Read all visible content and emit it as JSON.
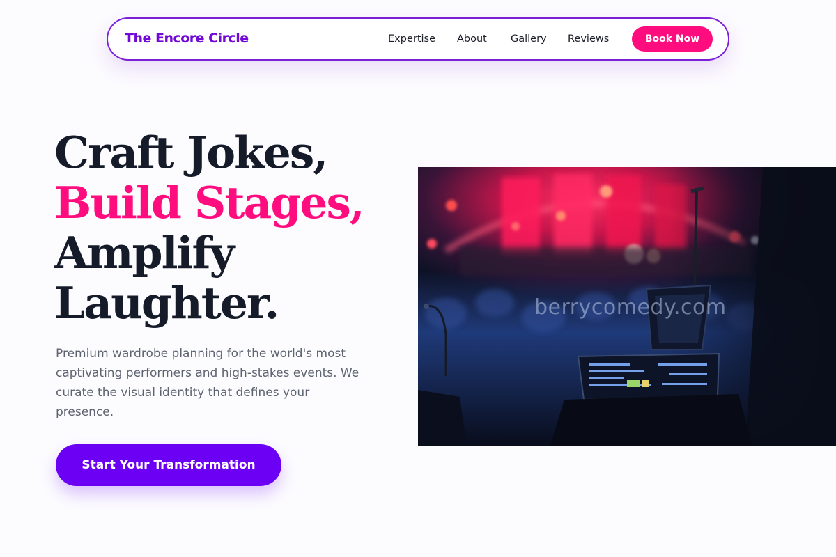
{
  "nav": {
    "brand": "The Encore Circle",
    "links": [
      "Expertise",
      "About",
      "Gallery",
      "Reviews"
    ],
    "cta_label": "Book Now"
  },
  "hero": {
    "headline": {
      "line1": "Craft Jokes,",
      "line2": "Build Stages,",
      "line3": "Amplify",
      "line4": "Laughter."
    },
    "subtext": "Premium wardrobe planning for the world's most captivating performers and high-stakes events. We curate the visual identity that defines your presence.",
    "cta_label": "Start Your Transformation",
    "image_watermark": "berrycomedy.com"
  },
  "colors": {
    "brand_purple": "#7209d6",
    "accent_pink": "#ff0c7e",
    "cta_purple": "#6b00f5",
    "heading_dark": "#151b29",
    "body_gray": "#5d6370"
  }
}
